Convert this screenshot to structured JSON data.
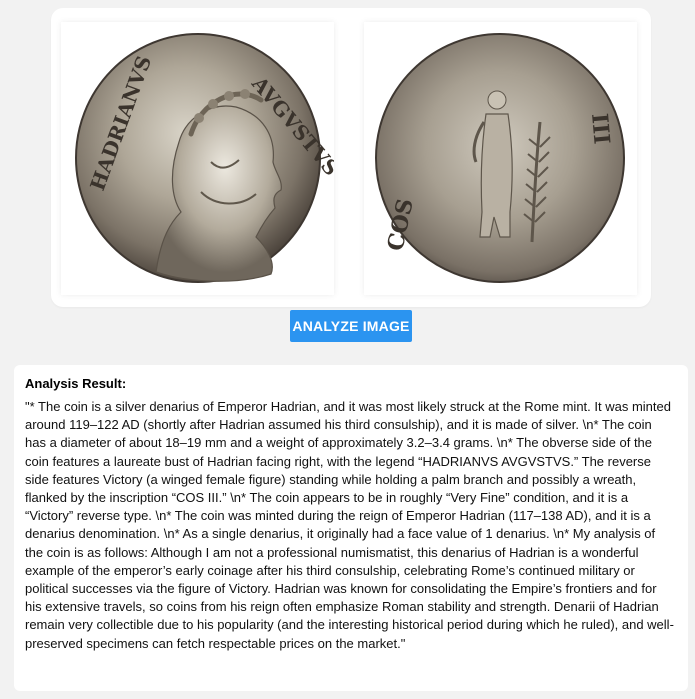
{
  "images": {
    "obverse": {
      "legend_left": "HADRIANVS",
      "legend_right": "AVGVSTVS",
      "alt": "obverse-coin"
    },
    "reverse": {
      "legend_left": "COS",
      "legend_right": "III",
      "alt": "reverse-coin"
    }
  },
  "actions": {
    "analyze_label": "ANALYZE IMAGE"
  },
  "result": {
    "title": "Analysis Result:",
    "text": "\"* The coin is a silver denarius of Emperor Hadrian, and it was most likely struck at the Rome mint. It was minted around 119–122 AD (shortly after Hadrian assumed his third consulship), and it is made of silver.  \\n* The coin has a diameter of about 18–19 mm and a weight of approximately 3.2–3.4 grams.  \\n* The obverse side of the coin features a laureate bust of Hadrian facing right, with the legend “HADRIANVS AVGVSTVS.” The reverse side features Victory (a winged female figure) standing while holding a palm branch and possibly a wreath, flanked by the inscription “COS III.”  \\n* The coin appears to be in roughly “Very Fine” condition, and it is a “Victory” reverse type.  \\n* The coin was minted during the reign of Emperor Hadrian (117–138 AD), and it is a denarius denomination.  \\n* As a single denarius, it originally had a face value of 1 denarius.  \\n* My analysis of the coin is as follows: Although I am not a professional numismatist, this denarius of Hadrian is a wonderful example of the emperor’s early coinage after his third consulship, celebrating Rome’s continued military or political successes via the figure of Victory. Hadrian was known for consolidating the Empire’s frontiers and for his extensive travels, so coins from his reign often emphasize Roman stability and strength. Denarii of Hadrian remain very collectible due to his popularity (and the interesting historical period during which he ruled), and well-preserved specimens can fetch respectable prices on the market.\""
  }
}
